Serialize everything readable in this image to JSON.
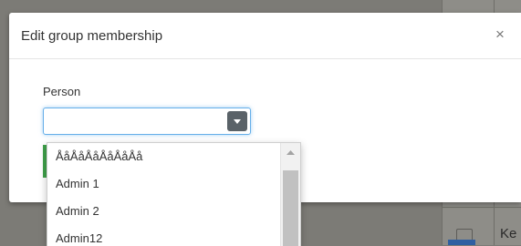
{
  "modal": {
    "title": "Edit group membership",
    "close_label": "×"
  },
  "form": {
    "person_label": "Person",
    "person_value": "",
    "options": [
      "ÅåÅåÅåÅåÅåÅå",
      "Admin 1",
      "Admin 2",
      "Admin12"
    ]
  },
  "background": {
    "cell_text": "Ke"
  },
  "colors": {
    "focus_border": "#66afe9",
    "toggle_button": "#5a6268",
    "success_edge": "#3fa14a"
  }
}
